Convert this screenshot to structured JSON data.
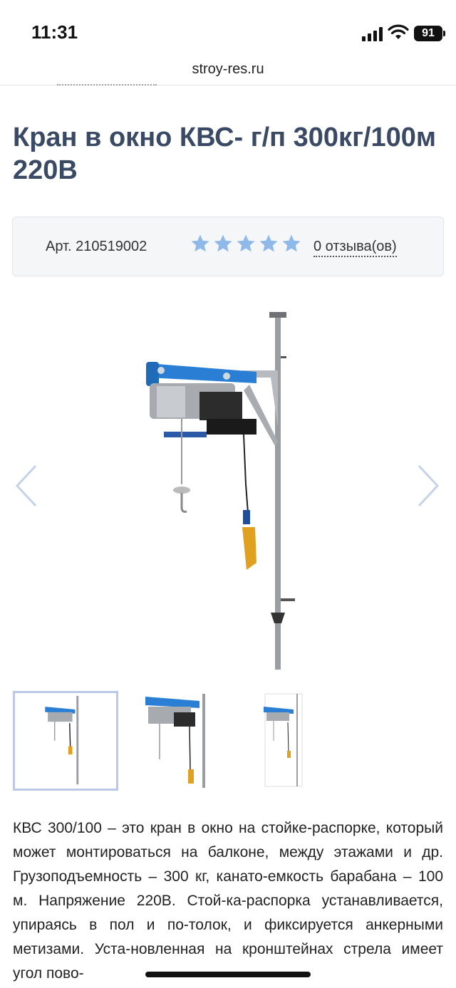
{
  "status_bar": {
    "time": "11:31",
    "battery": "91"
  },
  "browser": {
    "url": "stroy-res.ru"
  },
  "product": {
    "title": "Кран в окно КВС- г/п 300кг/100м 220В",
    "article": "Арт. 210519002",
    "rating": 0,
    "rating_max": 5,
    "reviews_link": "0 отзыва(ов)",
    "description": "КВС 300/100 – это кран в окно на стойке-распорке, который может монтироваться на балконе, между этажами и др. Грузоподъемность – 300 кг, канато-емкость барабана – 100 м. Напряжение 220В. Стой-ка-распорка устанавливается, упираясь в пол и по-толок, и фиксируется анкерными метизами. Уста-новленная на кронштейнах стрела имеет угол пово-"
  },
  "colors": {
    "title": "#3a4a64",
    "star": "#8fb9e8",
    "hoist_blue": "#2a7fd4",
    "active_thumb_border": "#b9c9e6"
  },
  "icons": {
    "signal": "signal-icon",
    "wifi": "wifi-icon",
    "battery": "battery-icon",
    "star": "star-icon",
    "prev": "chevron-left-icon",
    "next": "chevron-right-icon"
  }
}
